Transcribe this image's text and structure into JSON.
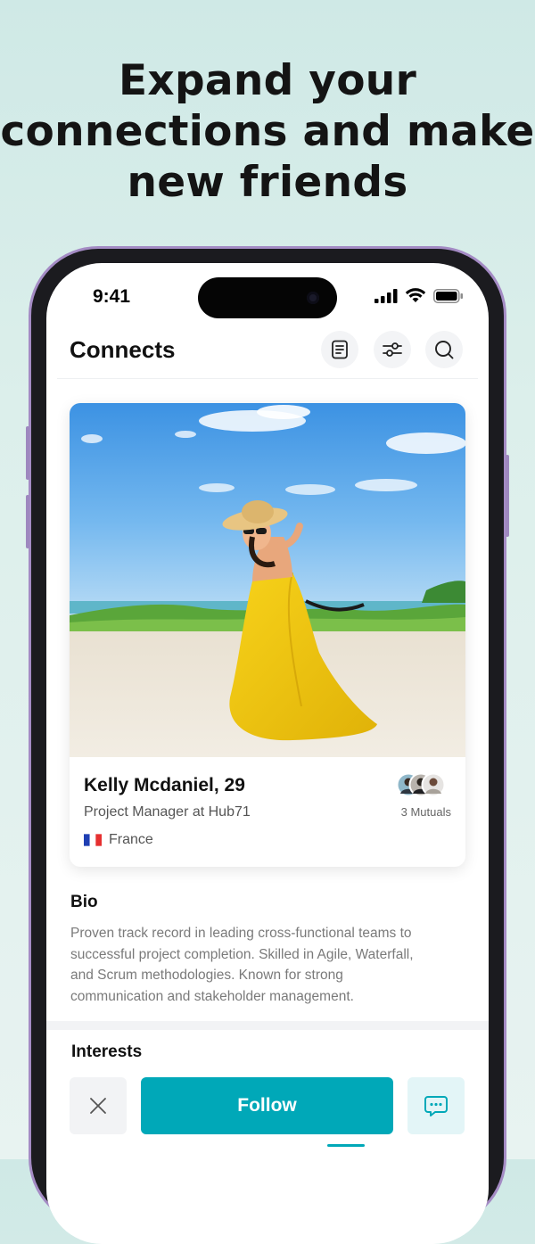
{
  "headline": {
    "line1": "Expand your",
    "line2": "connections and make",
    "line3": "new friends"
  },
  "status_bar": {
    "time": "9:41"
  },
  "header": {
    "title": "Connects",
    "icons": [
      "notebook-icon",
      "filter-sliders-icon",
      "search-icon"
    ]
  },
  "profile": {
    "name_age": "Kelly Mcdaniel, 29",
    "job": "Project Manager at Hub71",
    "country": "France",
    "mutuals": "3 Mutuals"
  },
  "bio": {
    "title": "Bio",
    "line1": "Proven track record in leading cross-functional teams to",
    "line2": "successful project completion. Skilled in Agile, Waterfall,",
    "line3": "and Scrum methodologies. Known for strong",
    "line4": "communication and stakeholder management."
  },
  "interests": {
    "title": "Interests"
  },
  "actions": {
    "follow_label": "Follow",
    "close_icon": "close-icon",
    "chat_icon": "chat-bubble-icon"
  },
  "colors": {
    "accent": "#00a8b8",
    "accent_light": "#e3f5f7",
    "frame": "#a48bc4"
  }
}
